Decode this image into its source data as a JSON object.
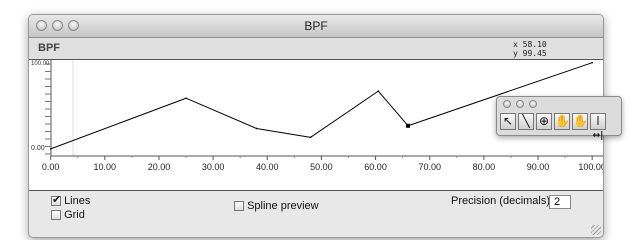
{
  "window": {
    "title": "BPF"
  },
  "header": {
    "label": "BPF",
    "coord_x": "x  58.10",
    "coord_y": "y  99.45"
  },
  "chart_data": {
    "type": "line",
    "x": [
      0,
      25,
      38,
      48,
      60.5,
      66,
      100
    ],
    "y": [
      0,
      57,
      23,
      13,
      65,
      26,
      97
    ],
    "selected_point_index": 5,
    "xlim": [
      -4,
      102
    ],
    "ylim": [
      -8,
      100
    ],
    "x_ticks": [
      "0.00",
      "10.00",
      "20.00",
      "30.00",
      "40.00",
      "50.00",
      "60.00",
      "70.00",
      "80.00",
      "90.00",
      "100.00"
    ],
    "y_tick_min": "0.00",
    "y_tick_max": "100.00",
    "line_color": "#000000"
  },
  "controls": {
    "lines_label": "Lines",
    "lines_checked": true,
    "grid_label": "Grid",
    "grid_checked": false,
    "spline_label": "Spline preview",
    "spline_checked": false,
    "precision_label": "Precision (decimals)",
    "precision_value": "2"
  },
  "palette": {
    "tools": [
      "arrow-tool",
      "pencil-tool",
      "zoom-tool",
      "hand-tool",
      "resize-hand-tool",
      "fit-width-tool"
    ]
  }
}
